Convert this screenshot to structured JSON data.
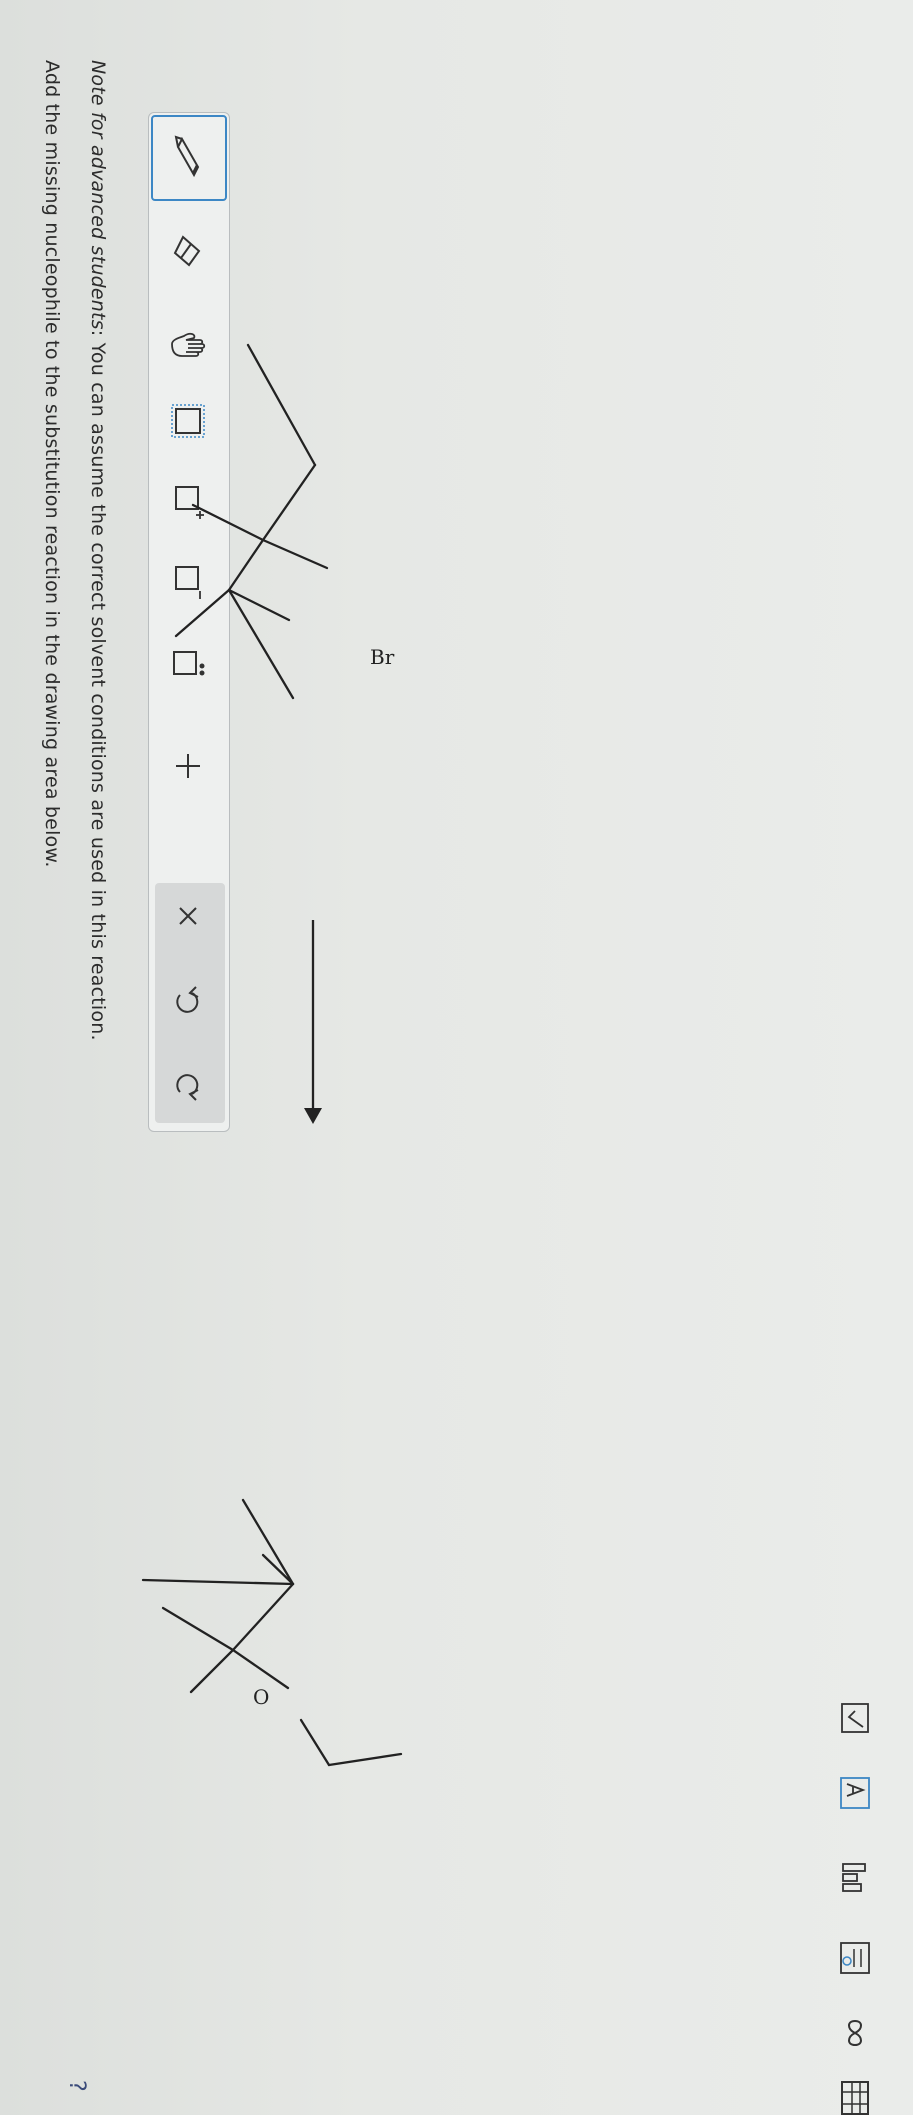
{
  "question": {
    "line1": "Add the missing nucleophile to the substitution reaction in the drawing area below.",
    "line2_prefix": "Note for advanced students",
    "line2_rest": ": You can assume the correct solvent conditions are used in this reaction."
  },
  "help": {
    "label": "?"
  },
  "toolbar": {
    "tools": [
      {
        "name": "pencil-tool",
        "icon": "pencil-icon",
        "selected": true
      },
      {
        "name": "eraser-tool",
        "icon": "eraser-icon"
      },
      {
        "name": "hand-tool",
        "icon": "hand-icon"
      },
      {
        "name": "select-tool",
        "icon": "dotted-square-icon"
      },
      {
        "name": "positive-charge-tool",
        "icon": "square-plus-icon"
      },
      {
        "name": "negative-charge-tool",
        "icon": "square-minus-icon"
      },
      {
        "name": "lone-pair-tool",
        "icon": "square-dots-icon"
      },
      {
        "name": "add-tool",
        "icon": "plus-icon",
        "label": "+"
      },
      {
        "name": "delete-tool",
        "icon": "x-icon",
        "label": "×"
      },
      {
        "name": "undo-tool",
        "icon": "undo-icon"
      },
      {
        "name": "redo-tool",
        "icon": "redo-icon"
      }
    ]
  },
  "reaction": {
    "reactant_label": "Br",
    "product_label": "O"
  },
  "colors": {
    "accent": "#3c87c5",
    "link": "#3a4b7a",
    "ink": "#222222"
  }
}
